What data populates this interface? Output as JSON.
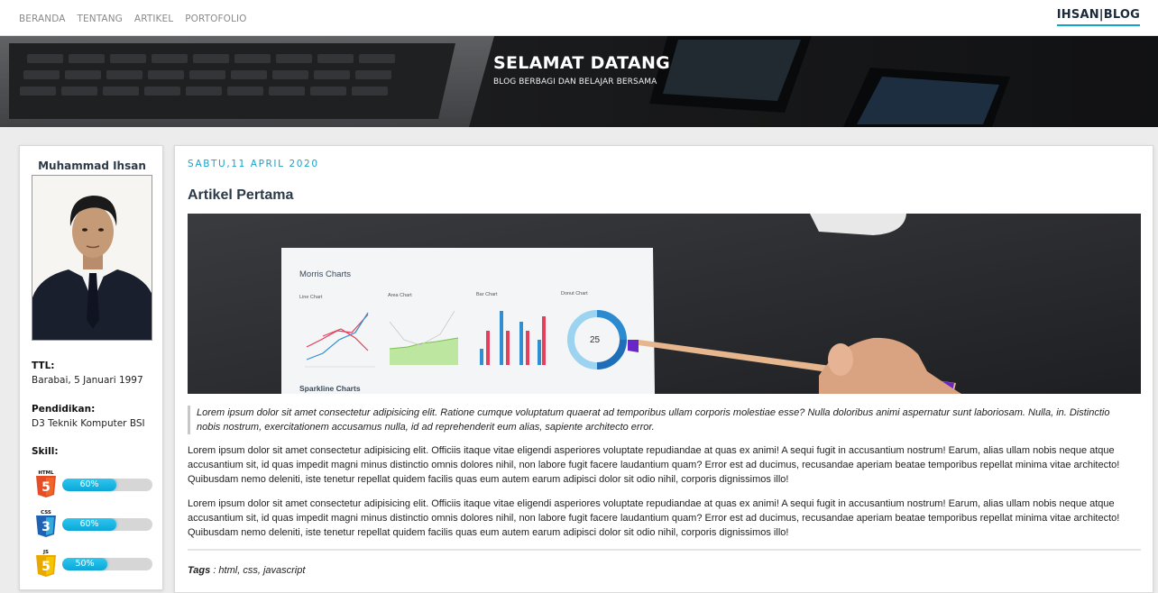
{
  "nav": {
    "links": [
      "BERANDA",
      "TENTANG",
      "ARTIKEL",
      "PORTOFOLIO"
    ],
    "brand": "IHSAN|BLOG"
  },
  "hero": {
    "title": "SELAMAT DATANG",
    "subtitle": "BLOG BERBAGI DAN BELAJAR BERSAMA"
  },
  "profile": {
    "name": "Muhammad Ihsan",
    "ttl_label": "TTL:",
    "ttl_value": "Barabai, 5 Januari 1997",
    "pendidikan_label": "Pendidikan:",
    "pendidikan_value": "D3 Teknik Komputer BSI",
    "skill_label": "Skill:",
    "skills": [
      {
        "name": "HTML",
        "icon": "html5-icon",
        "color": "#e44d26",
        "percent": 60,
        "label": "60%"
      },
      {
        "name": "CSS",
        "icon": "css3-icon",
        "color": "#1f62b4",
        "percent": 60,
        "label": "60%"
      },
      {
        "name": "JS",
        "icon": "javascript-icon",
        "color": "#f0b400",
        "percent": 50,
        "label": "50%"
      }
    ]
  },
  "article": {
    "date": "SABTU,11 APRIL 2020",
    "title": "Artikel Pertama",
    "image_text": {
      "heading": "Morris Charts",
      "line": "Line Chart",
      "area": "Area Chart",
      "bar": "Bar Chart",
      "donut": "Donut Chart",
      "donut_value": "25",
      "sparkline": "Sparkline Charts"
    },
    "quote": "Lorem ipsum dolor sit amet consectetur adipisicing elit. Ratione cumque voluptatum quaerat ad temporibus ullam corporis molestiae esse? Nulla doloribus animi aspernatur sunt laboriosam. Nulla, in. Distinctio nobis nostrum, exercitationem accusamus nulla, id ad reprehenderit eum alias, sapiente architecto error.",
    "paragraphs": [
      "Lorem ipsum dolor sit amet consectetur adipisicing elit. Officiis itaque vitae eligendi asperiores voluptate repudiandae at quas ex animi! A sequi fugit in accusantium nostrum! Earum, alias ullam nobis neque atque accusantium sit, id quas impedit magni minus distinctio omnis dolores nihil, non labore fugit facere laudantium quam? Error est ad ducimus, recusandae aperiam beatae temporibus repellat minima vitae architecto! Quibusdam nemo deleniti, iste tenetur repellat quidem facilis quas eum autem earum adipisci dolor sit odio nihil, corporis dignissimos illo!",
      "Lorem ipsum dolor sit amet consectetur adipisicing elit. Officiis itaque vitae eligendi asperiores voluptate repudiandae at quas ex animi! A sequi fugit in accusantium nostrum! Earum, alias ullam nobis neque atque accusantium sit, id quas impedit magni minus distinctio omnis dolores nihil, non labore fugit facere laudantium quam? Error est ad ducimus, recusandae aperiam beatae temporibus repellat minima vitae architecto! Quibusdam nemo deleniti, iste tenetur repellat quidem facilis quas eum autem earum adipisci dolor sit odio nihil, corporis dignissimos illo!"
    ],
    "tags_label": "Tags",
    "tags_value": " : html, css, javascript"
  },
  "colors": {
    "accent": "#12a5c9",
    "skill_bar": "#0aa7d8"
  }
}
